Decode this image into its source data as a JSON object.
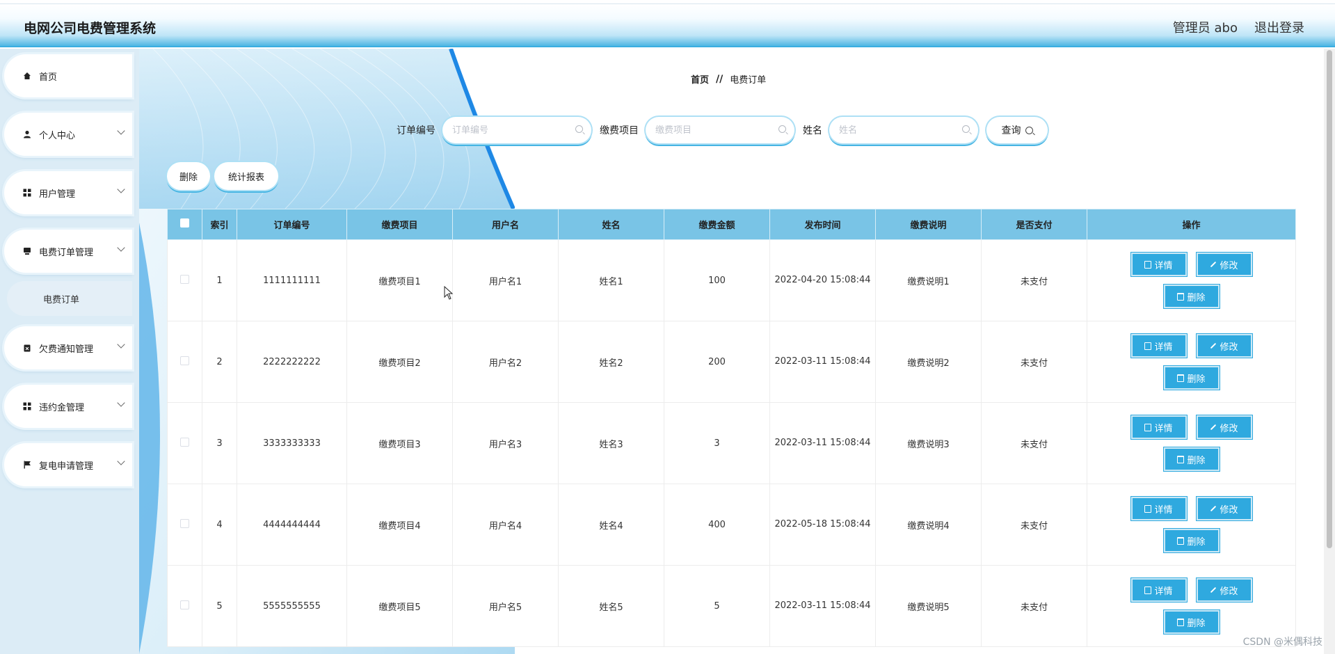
{
  "header": {
    "title": "电网公司电费管理系统",
    "admin": "管理员 abo",
    "logout": "退出登录"
  },
  "sidebar": {
    "items": [
      {
        "label": "首页",
        "icon": "home-icon"
      },
      {
        "label": "个人中心",
        "icon": "user-icon"
      },
      {
        "label": "用户管理",
        "icon": "grid-icon"
      },
      {
        "label": "电费订单管理",
        "icon": "card-icon"
      },
      {
        "label": "欠费通知管理",
        "icon": "clipboard-icon"
      },
      {
        "label": "违约金管理",
        "icon": "grid-icon"
      },
      {
        "label": "复电申请管理",
        "icon": "flag-icon"
      }
    ],
    "sub_item": "电费订单"
  },
  "breadcrumb": {
    "home": "首页",
    "sep": "//",
    "current": "电费订单"
  },
  "search": {
    "order_label": "订单编号",
    "order_placeholder": "订单编号",
    "item_label": "缴费项目",
    "item_placeholder": "缴费项目",
    "name_label": "姓名",
    "name_placeholder": "姓名",
    "query": "查询"
  },
  "actions": {
    "delete": "删除",
    "report": "统计报表"
  },
  "table": {
    "headers": [
      "索引",
      "订单编号",
      "缴费项目",
      "用户名",
      "姓名",
      "缴费金额",
      "发布时间",
      "缴费说明",
      "是否支付",
      "操作"
    ],
    "rows": [
      [
        "1",
        "1111111111",
        "缴费项目1",
        "用户名1",
        "姓名1",
        "100",
        "2022-04-20 15:08:44",
        "缴费说明1",
        "未支付"
      ],
      [
        "2",
        "2222222222",
        "缴费项目2",
        "用户名2",
        "姓名2",
        "200",
        "2022-03-11 15:08:44",
        "缴费说明2",
        "未支付"
      ],
      [
        "3",
        "3333333333",
        "缴费项目3",
        "用户名3",
        "姓名3",
        "3",
        "2022-03-11 15:08:44",
        "缴费说明3",
        "未支付"
      ],
      [
        "4",
        "4444444444",
        "缴费项目4",
        "用户名4",
        "姓名4",
        "400",
        "2022-05-18 15:08:44",
        "缴费说明4",
        "未支付"
      ],
      [
        "5",
        "5555555555",
        "缴费项目5",
        "用户名5",
        "姓名5",
        "5",
        "2022-03-11 15:08:44",
        "缴费说明5",
        "未支付"
      ]
    ],
    "ops": {
      "detail": "详情",
      "edit": "修改",
      "delete": "删除"
    }
  },
  "watermark": "CSDN @米偶科技",
  "colors": {
    "accent": "#2fa9df",
    "header_th": "#79c4e6",
    "sidebar_bg": "#dcecf6"
  }
}
